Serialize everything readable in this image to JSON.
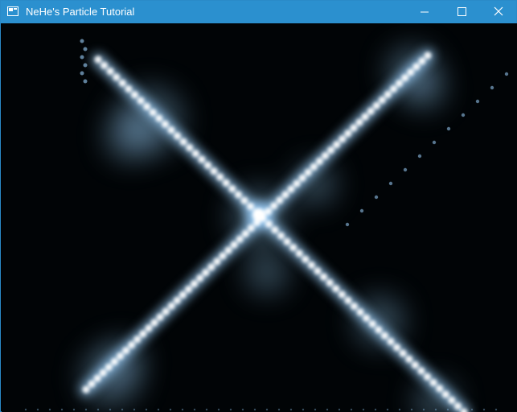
{
  "window": {
    "title": "NeHe's Particle Tutorial"
  },
  "titlebar": {
    "icon": "app-window-icon",
    "controls": [
      {
        "name": "minimize-button",
        "icon": "minimize-icon"
      },
      {
        "name": "maximize-button",
        "icon": "maximize-icon"
      },
      {
        "name": "close-button",
        "icon": "close-icon"
      }
    ]
  },
  "canvas": {
    "content": "particle-system-render",
    "particle_color": "#9fd4ff",
    "core_color": "#ffffff",
    "background_color": "#000000"
  },
  "colors": {
    "titlebar": "#2b90cf",
    "title_text": "#ffffff"
  }
}
